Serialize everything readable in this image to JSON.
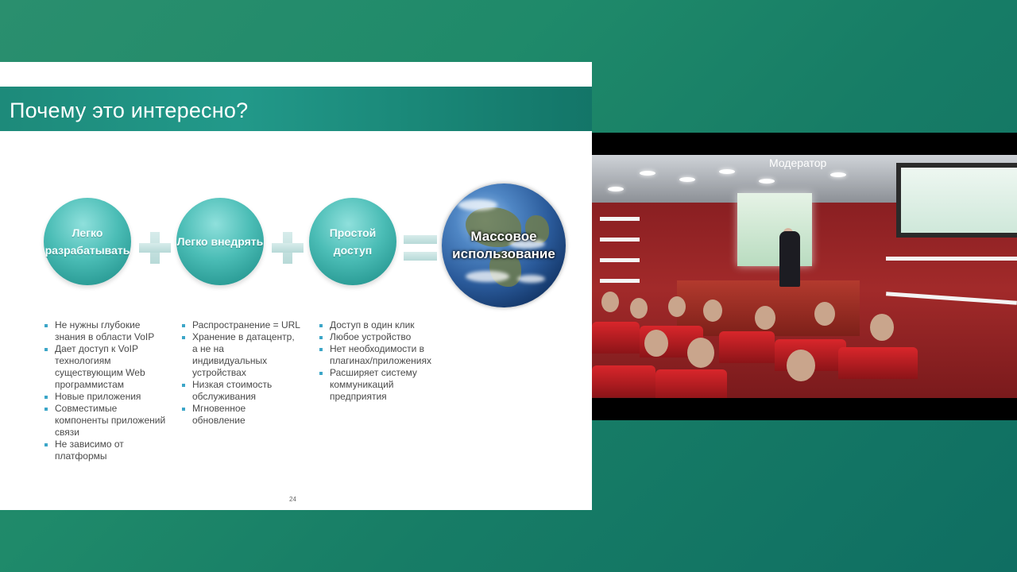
{
  "slide": {
    "title": "Почему это интересно?",
    "circles": [
      "Легко разрабатывать",
      "Легко внедрять",
      "Простой доступ"
    ],
    "result": "Массовое использование",
    "columns": [
      [
        "Не нужны глубокие знания в области VoIP",
        "Дает доступ к VoIP технологиям существующим Web программистам",
        "Новые приложения",
        "Совместимые компоненты приложений связи",
        "Не зависимо от платформы"
      ],
      [
        "Распространение = URL",
        "Хранение в датацентр, а не на индивидуальных устройствах",
        "Низкая стоимость обслуживания",
        "Мгновенное обновление"
      ],
      [
        "Доступ в один клик",
        "Любое устройство",
        "Нет необходимости в плагинах/приложениях",
        "Расширяет систему коммуникаций предприятия"
      ]
    ],
    "page_number": "24"
  },
  "video": {
    "label": "Модератор"
  },
  "colors": {
    "background": "#1f8a6a",
    "header": "#1d8a7a",
    "circle": "#4bbdb6",
    "bullet": "#3ca6c8"
  },
  "icons": [
    "plus-icon",
    "equals-icon",
    "globe-image"
  ]
}
